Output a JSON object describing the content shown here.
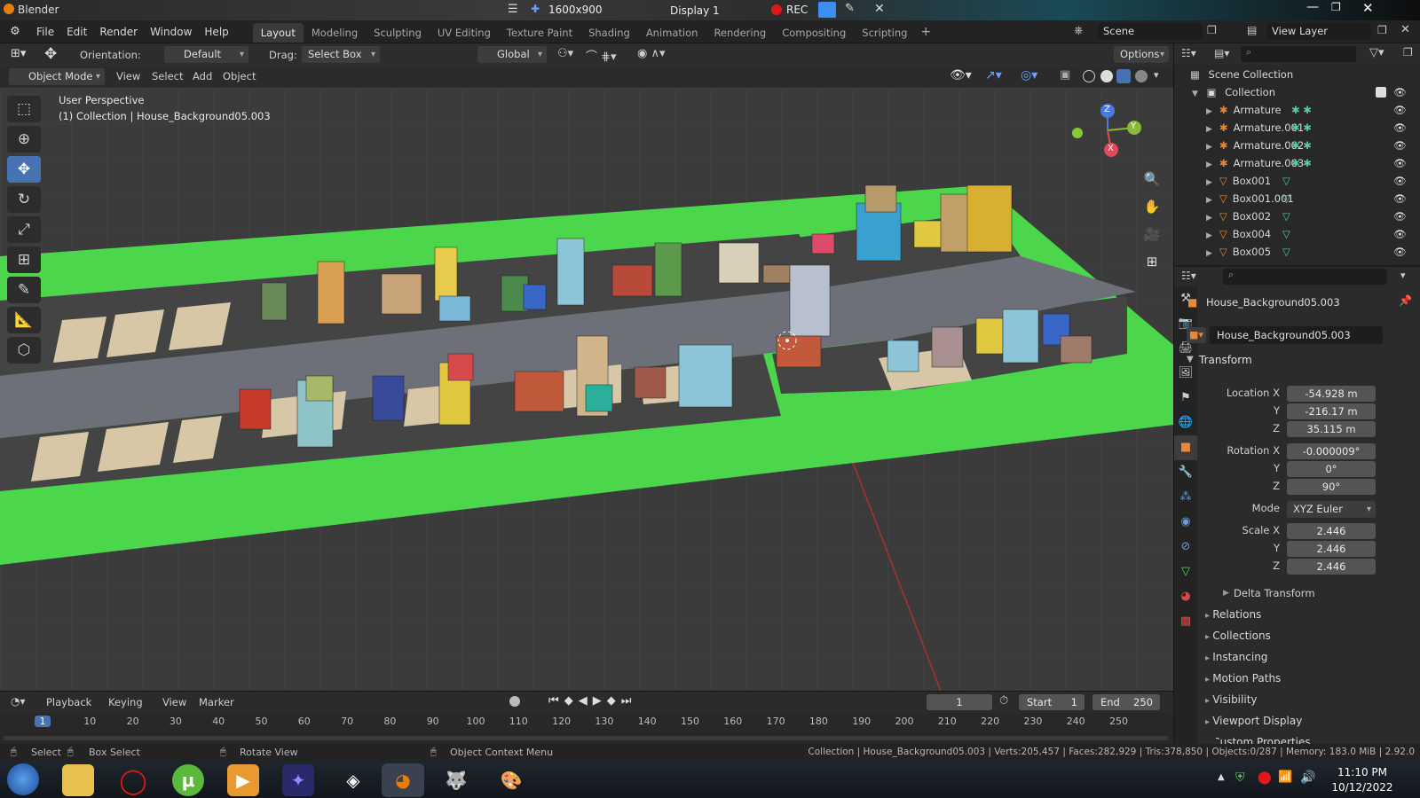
{
  "window": {
    "app_title": "Blender",
    "resolution": "1600x900",
    "display": "Display 1",
    "rec": "REC"
  },
  "menu": [
    "File",
    "Edit",
    "Render",
    "Window",
    "Help"
  ],
  "workspaces": [
    "Layout",
    "Modeling",
    "Sculpting",
    "UV Editing",
    "Texture Paint",
    "Shading",
    "Animation",
    "Rendering",
    "Compositing",
    "Scripting"
  ],
  "active_workspace": "Layout",
  "scene": "Scene",
  "view_layer": "View Layer",
  "toolbar": {
    "orientation_label": "Orientation:",
    "orientation_value": "Default",
    "drag_label": "Drag:",
    "drag_value": "Select Box",
    "transform_orientation": "Global",
    "options": "Options"
  },
  "header": {
    "mode": "Object Mode",
    "items": [
      "View",
      "Select",
      "Add",
      "Object"
    ]
  },
  "viewport": {
    "perspective": "User Perspective",
    "collection_info": "(1) Collection | House_Background05.003",
    "gizmo": {
      "x": "X",
      "y": "Y",
      "z": "Z"
    }
  },
  "outliner": {
    "root": "Scene Collection",
    "collection": "Collection",
    "items": [
      {
        "name": "Armature",
        "type": "armature"
      },
      {
        "name": "Armature.001",
        "type": "armature"
      },
      {
        "name": "Armature.002",
        "type": "armature"
      },
      {
        "name": "Armature.003",
        "type": "armature"
      },
      {
        "name": "Box001",
        "type": "mesh"
      },
      {
        "name": "Box001.001",
        "type": "mesh"
      },
      {
        "name": "Box002",
        "type": "mesh"
      },
      {
        "name": "Box004",
        "type": "mesh"
      },
      {
        "name": "Box005",
        "type": "mesh"
      }
    ]
  },
  "properties": {
    "object_name": "House_Background05.003",
    "data_name": "House_Background05.003",
    "transform_title": "Transform",
    "location": {
      "label": "Location X",
      "x": "-54.928 m",
      "y": "-216.17 m",
      "z": "35.115 m"
    },
    "rotation": {
      "label": "Rotation X",
      "x": "-0.000009°",
      "y": "0°",
      "z": "90°"
    },
    "mode_label": "Mode",
    "mode_value": "XYZ Euler",
    "scale": {
      "label": "Scale X",
      "x": "2.446",
      "y": "2.446",
      "z": "2.446"
    },
    "axis_y": "Y",
    "axis_z": "Z",
    "delta": "Delta Transform",
    "panels": [
      "Relations",
      "Collections",
      "Instancing",
      "Motion Paths",
      "Visibility",
      "Viewport Display",
      "Custom Properties"
    ]
  },
  "timeline": {
    "menus": [
      "Playback",
      "Keying",
      "View",
      "Marker"
    ],
    "current_frame": "1",
    "start_label": "Start",
    "start": "1",
    "end_label": "End",
    "end": "250",
    "ticks": [
      "1",
      "10",
      "20",
      "30",
      "40",
      "50",
      "60",
      "70",
      "80",
      "90",
      "100",
      "110",
      "120",
      "130",
      "140",
      "150",
      "160",
      "170",
      "180",
      "190",
      "200",
      "210",
      "220",
      "230",
      "240",
      "250"
    ]
  },
  "statusbar": {
    "select": "Select",
    "box_select": "Box Select",
    "rotate_view": "Rotate View",
    "context_menu": "Object Context Menu",
    "stats": "Collection | House_Background05.003 | Verts:205,457 | Faces:282,929 | Tris:378,850 | Objects:0/287 | Memory: 183.0 MiB | 2.92.0"
  },
  "taskbar": {
    "time": "11:10 PM",
    "date": "10/12/2022"
  },
  "colors": {
    "accent": "#4772b3",
    "ground": "#4bd64b",
    "road": "#6e7079",
    "sand": "#d8c7a6"
  }
}
